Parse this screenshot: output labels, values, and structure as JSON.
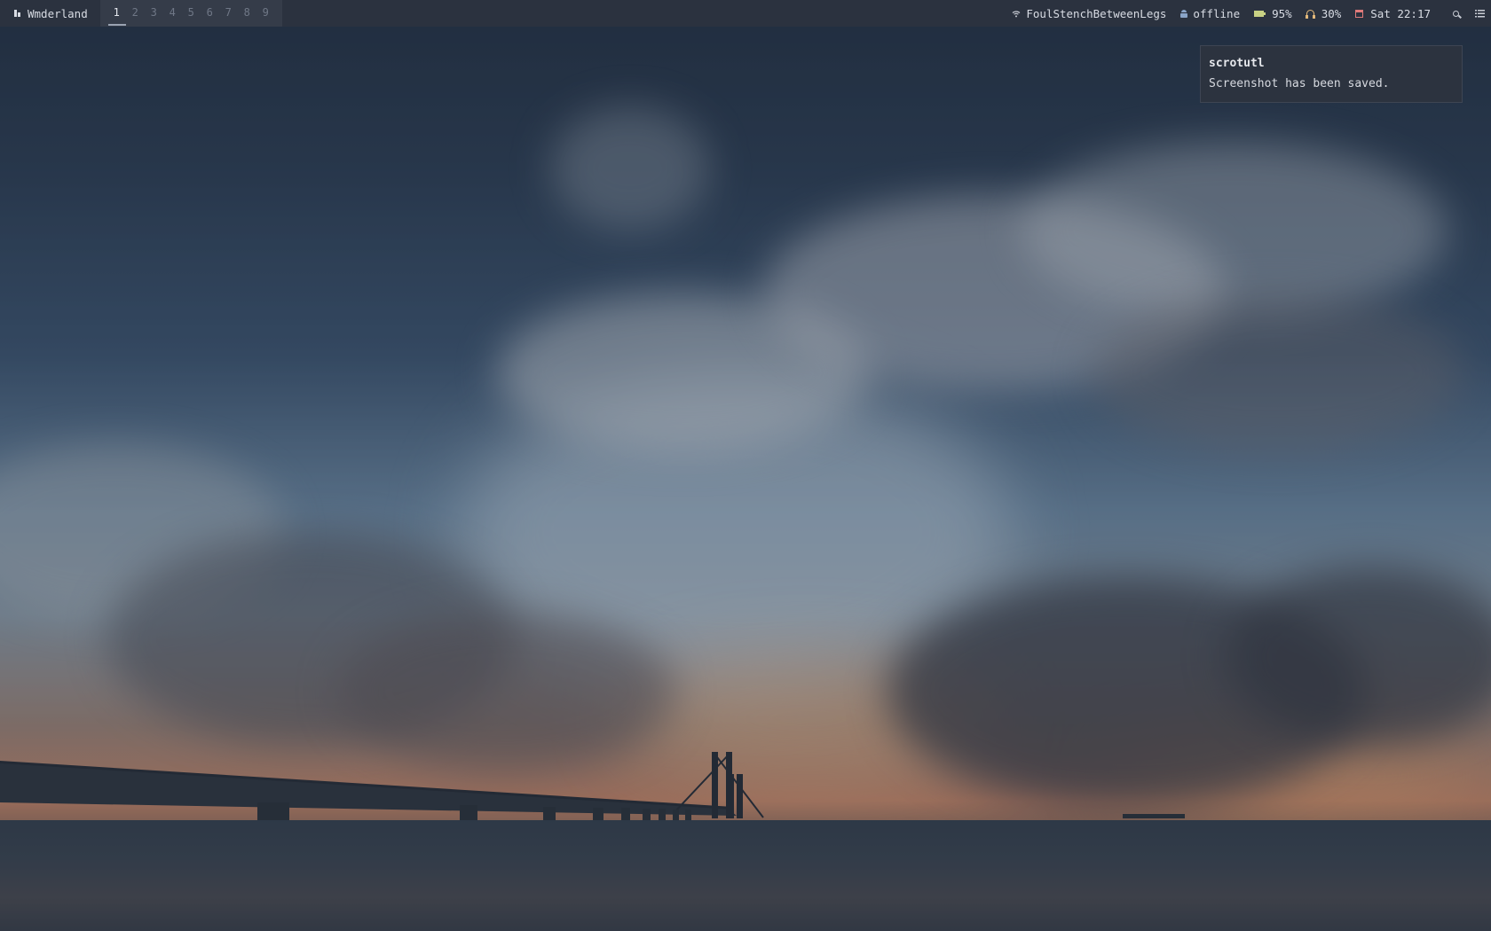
{
  "topbar": {
    "wm_name": "Wmderland",
    "workspaces": [
      "1",
      "2",
      "3",
      "4",
      "5",
      "6",
      "7",
      "8",
      "9"
    ],
    "active_workspace": "1",
    "wifi": {
      "icon": "wifi-icon",
      "ssid": "FoulStenchBetweenLegs"
    },
    "network": {
      "icon": "network-icon",
      "status": "offline"
    },
    "battery": {
      "icon": "battery-icon",
      "level": "95%",
      "color": "#c8d184"
    },
    "volume": {
      "icon": "headphones-icon",
      "level": "30%",
      "color": "#e2b87a"
    },
    "clock": {
      "icon": "calendar-icon",
      "time": "Sat 22:17",
      "color": "#e07a7a"
    }
  },
  "notification": {
    "summary": "scrotutl",
    "body": "Screenshot has been saved."
  }
}
